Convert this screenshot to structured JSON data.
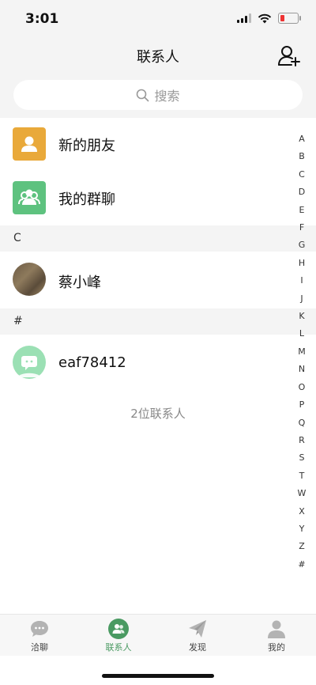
{
  "status": {
    "time": "3:01"
  },
  "nav": {
    "title": "联系人"
  },
  "search": {
    "placeholder": "搜索"
  },
  "entries": {
    "new_friends": "新的朋友",
    "my_groups": "我的群聊"
  },
  "sections": [
    {
      "header": "C",
      "contacts": [
        {
          "name": "蔡小峰"
        }
      ]
    },
    {
      "header": "#",
      "contacts": [
        {
          "name": "eaf78412"
        }
      ]
    }
  ],
  "contact_count": "2位联系人",
  "index_letters": [
    "A",
    "B",
    "C",
    "D",
    "E",
    "F",
    "G",
    "H",
    "I",
    "J",
    "K",
    "L",
    "M",
    "N",
    "O",
    "P",
    "Q",
    "R",
    "S",
    "T",
    "W",
    "X",
    "Y",
    "Z",
    "#"
  ],
  "tabs": [
    {
      "label": "洽聊",
      "icon": "chat-bubble-icon",
      "active": false
    },
    {
      "label": "联系人",
      "icon": "contacts-icon",
      "active": true
    },
    {
      "label": "发现",
      "icon": "paper-plane-icon",
      "active": false
    },
    {
      "label": "我的",
      "icon": "user-profile-icon",
      "active": false
    }
  ],
  "colors": {
    "accent_green": "#4a9a62",
    "new_friends_bg": "#e9a93a",
    "groups_bg": "#5ec27f",
    "battery_low": "#e33333"
  }
}
